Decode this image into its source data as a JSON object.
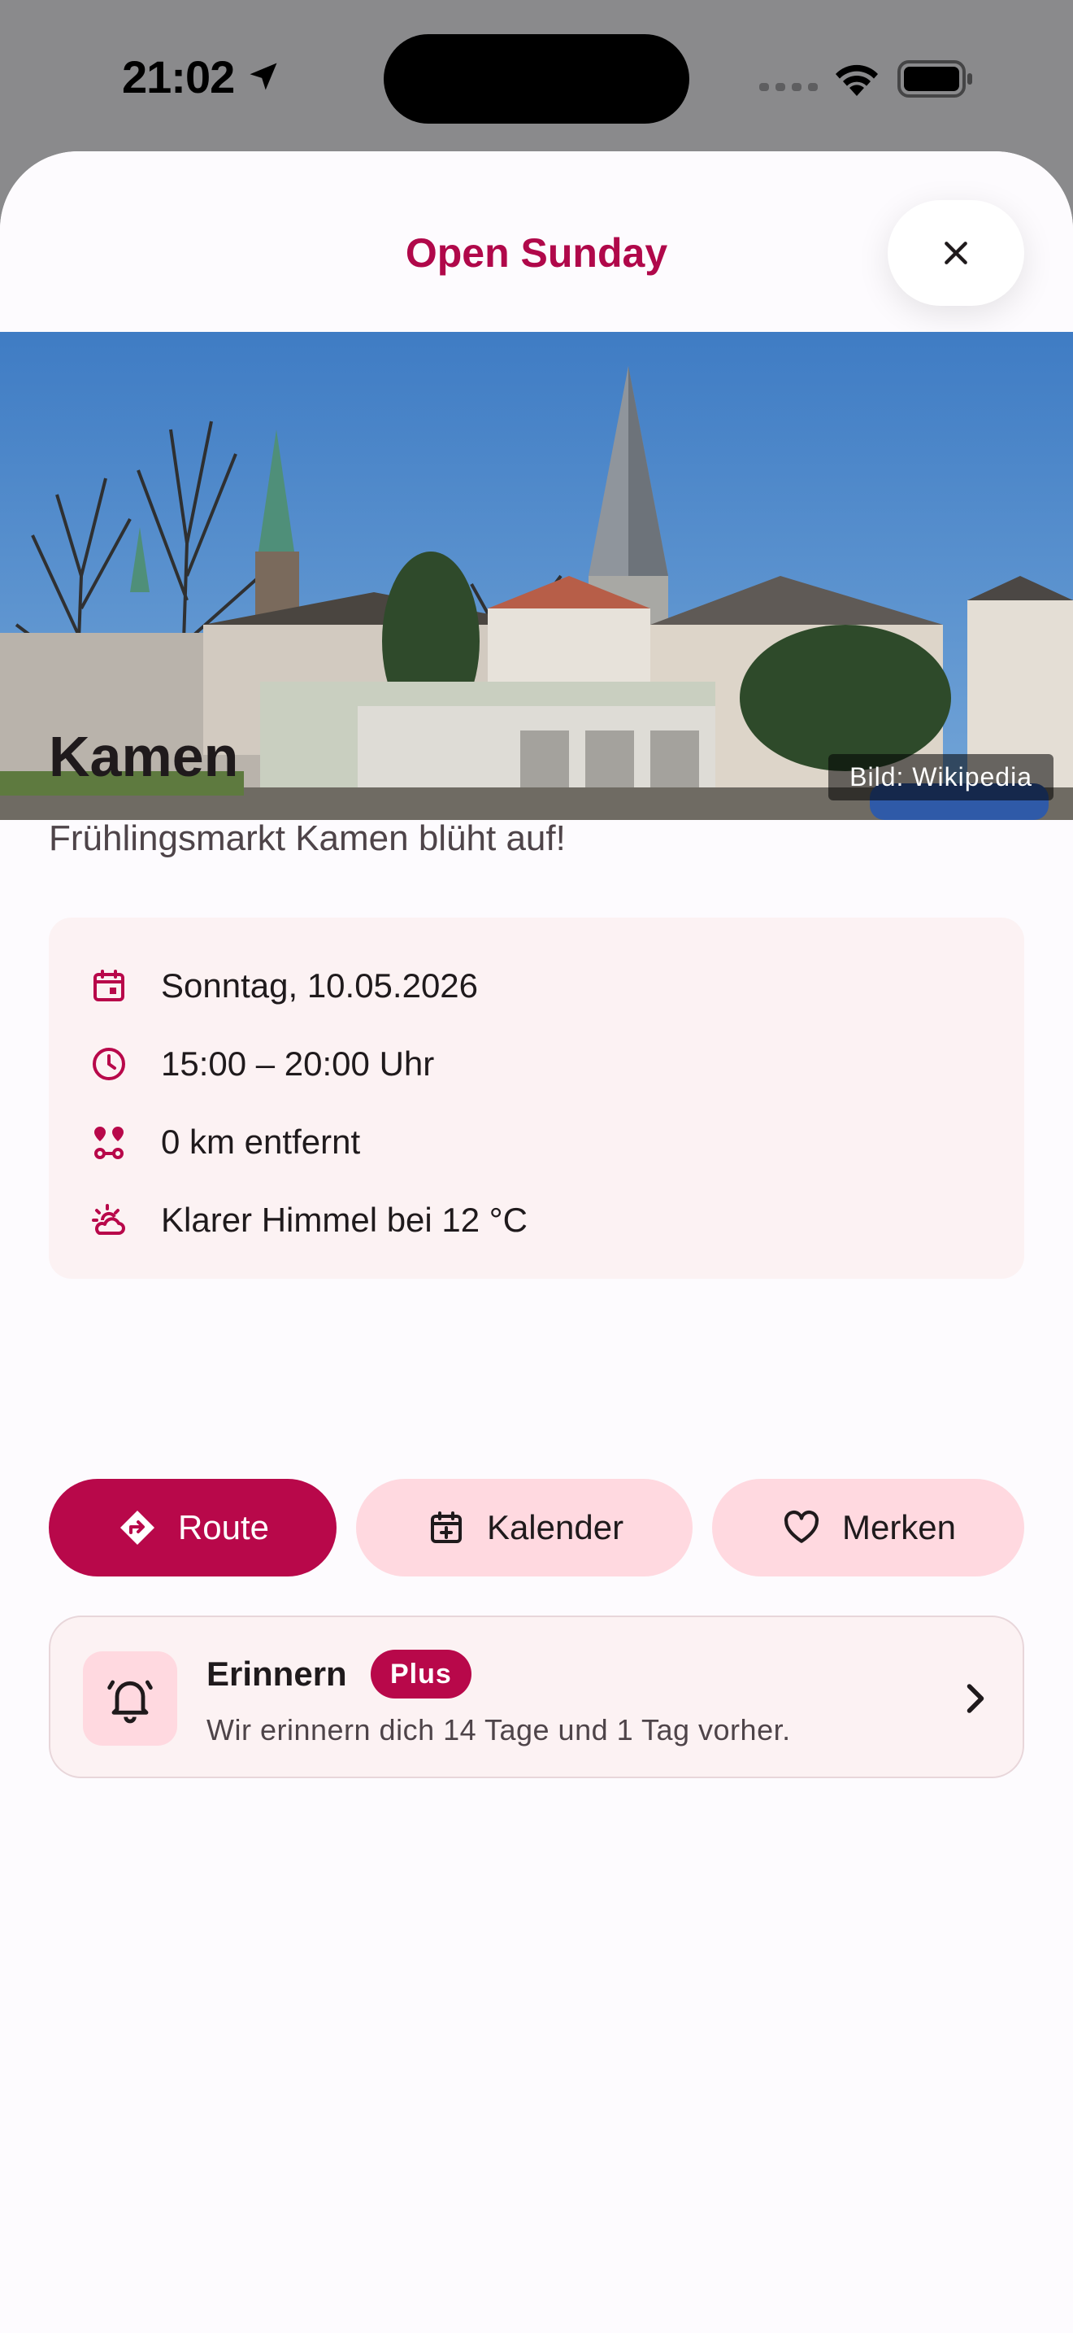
{
  "status_bar": {
    "time": "21:02"
  },
  "header": {
    "title": "Open Sunday"
  },
  "hero": {
    "attribution": "Bild: Wikipedia"
  },
  "event": {
    "title": "Kamen",
    "subtitle": "Frühlingsmarkt Kamen blüht auf!",
    "details": {
      "date": "Sonntag, 10.05.2026",
      "time": "15:00 – 20:00 Uhr",
      "distance": "0 km entfernt",
      "weather": "Klarer Himmel bei 12 °C"
    }
  },
  "actions": {
    "route": "Route",
    "calendar": "Kalender",
    "save": "Merken"
  },
  "reminder": {
    "title": "Erinnern",
    "badge": "Plus",
    "description": "Wir erinnern dich 14 Tage und 1 Tag vorher."
  },
  "colors": {
    "accent": "#b8084a",
    "accent_light": "#ffd9e0",
    "card_bg": "#fcf2f3"
  },
  "icons": {
    "status": [
      "location-arrow-icon",
      "signal-icon",
      "wifi-icon",
      "battery-icon"
    ],
    "details": [
      "calendar-icon",
      "clock-icon",
      "route-pins-icon",
      "weather-icon"
    ],
    "actions": [
      "directions-icon",
      "calendar-add-icon",
      "heart-icon"
    ],
    "reminder": "bell-icon",
    "close": "close-icon",
    "chevron": "chevron-right-icon"
  }
}
